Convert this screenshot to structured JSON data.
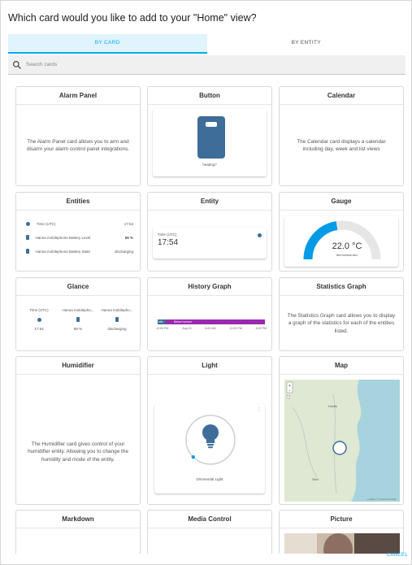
{
  "dialog": {
    "title": "Which card would you like to add to your \"Home\" view?",
    "tabs": [
      {
        "label": "BY CARD",
        "active": true
      },
      {
        "label": "BY ENTITY",
        "active": false
      }
    ],
    "search": {
      "placeholder": "Search cards"
    },
    "cancel_label": "CANCEL"
  },
  "colors": {
    "accent": "#03a9f4",
    "tab_active_bg": "#e1f3fd",
    "gauge": "#039be5",
    "history_bar": "#9c27b0",
    "button_device": "#3e6d99"
  },
  "cards": {
    "alarm_panel": {
      "title": "Alarm Panel",
      "description": "The Alarm Panel card allows you to arm and disarm your alarm control panel integrations."
    },
    "button": {
      "title": "Button",
      "label": "heating?"
    },
    "calendar": {
      "title": "Calendar",
      "description": "The Calendar card displays a calendar including day, week and list views"
    },
    "entities": {
      "title": "Entities",
      "rows": [
        {
          "name": "Time (UTC)",
          "value": "17:54"
        },
        {
          "name": "Hanna mobilephone Battery Level",
          "value": "88 %"
        },
        {
          "name": "Hanna mobilephone Battery State",
          "value": "discharging"
        }
      ]
    },
    "entity": {
      "title": "Entity",
      "name": "Time (UTC)",
      "value": "17:54"
    },
    "gauge": {
      "title": "Gauge",
      "value": "22.0 °C",
      "name": "thermostat.aux",
      "fraction": 0.45
    },
    "glance": {
      "title": "Glance",
      "items": [
        {
          "name": "Time (UTC)",
          "value": "17:54"
        },
        {
          "name": "Hanna mobilepho...",
          "value": "88 %"
        },
        {
          "name": "Hanna mobilepho...",
          "value": "discharging"
        }
      ]
    },
    "history_graph": {
      "title": "History Graph",
      "legend_left": "Idle",
      "bar_label": "Below horizon",
      "ticks": [
        "12:00 PM",
        "Aug 24",
        "6:00 AM",
        "12:00 PM",
        "6:00 PM"
      ]
    },
    "statistics_graph": {
      "title": "Statistics Graph",
      "description": "The Statistics Graph card allows you to display a graph of the statistics for each of the entities listed."
    },
    "humidifier": {
      "title": "Humidifier",
      "description": "The Humidifier card gives control of your humidifier entity. Allowing you to change the humidity and mode of the entity."
    },
    "light": {
      "title": "Light",
      "name": "Dimmerdal Light",
      "brightness": 0.0
    },
    "map": {
      "title": "Map",
      "places": [
        "Hovås",
        "Särö"
      ],
      "attribution": "Leaflet | © OpenStreetMap"
    },
    "markdown": {
      "title": "Markdown"
    },
    "media_control": {
      "title": "Media Control"
    },
    "picture": {
      "title": "Picture"
    }
  }
}
